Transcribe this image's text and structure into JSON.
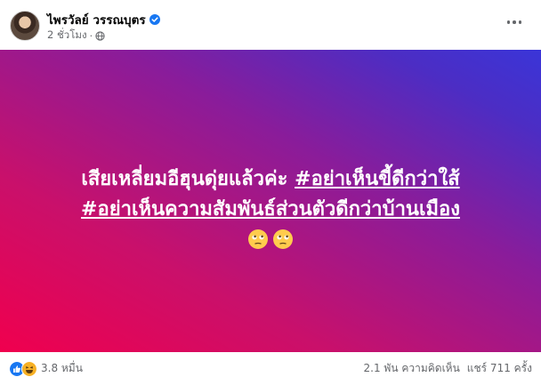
{
  "post": {
    "author": "ไพรวัลย์ วรรณบุตร",
    "time": "2 ชั่วโมง",
    "separator": "·"
  },
  "banner": {
    "line1_plain": "เสียเหลี่ยมอีฮุนดุ่ยแล้วค่ะ ",
    "line1_hashtag": "#อย่าเห็นขี้ดีกว่าใส้",
    "line2_hashtag": "#อย่าเห็นความสัมพันธ์ส่วนตัวดีกว่าบ้านเมือง"
  },
  "footer": {
    "reactions_count": "3.8 หมื่น",
    "comments": "2.1 พัน ความคิดเห็น",
    "shares": "แชร์ 711 ครั้ง"
  },
  "icons": {
    "verified": "verified-badge-icon",
    "audience": "globe-icon",
    "more": "more-options-icon",
    "reaction_1": "like-icon",
    "reaction_2": "haha-icon",
    "emoji": "face-with-rolling-eyes-icon"
  },
  "colors": {
    "verified_blue": "#1877f2",
    "gradient_start": "#f0004e",
    "gradient_mid": "#8a1c9a",
    "gradient_end": "#3a35d8",
    "secondary_text": "#65676b"
  }
}
